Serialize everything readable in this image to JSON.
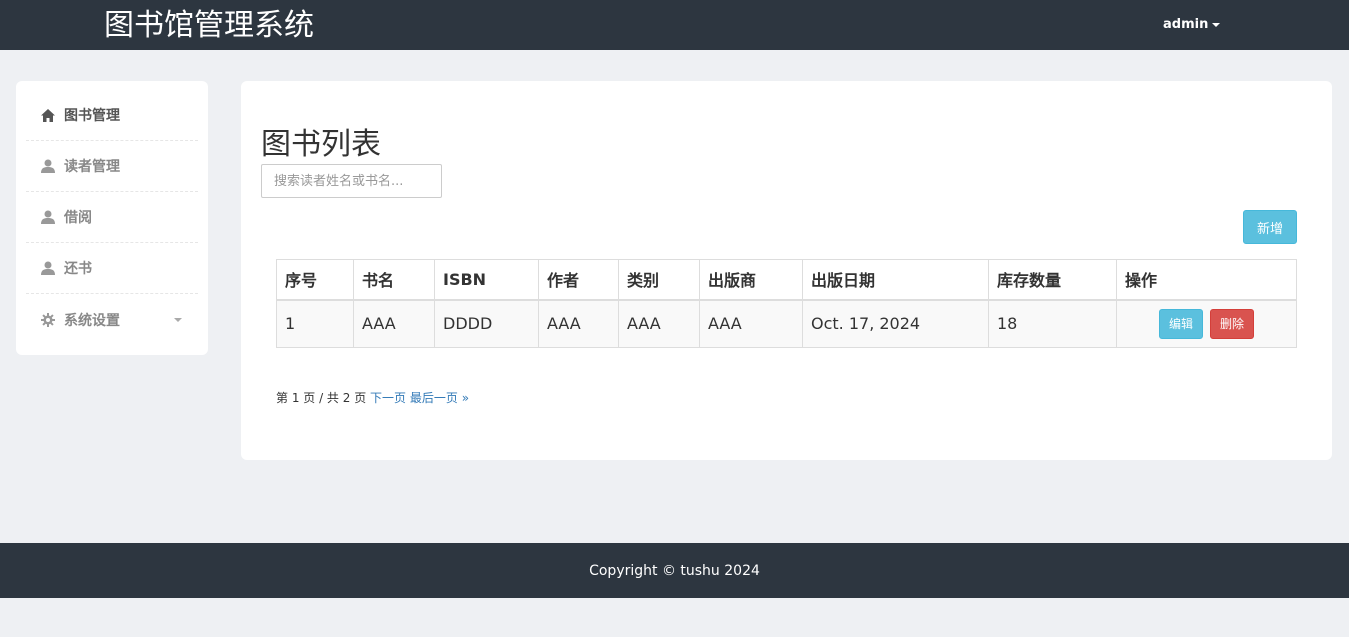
{
  "header": {
    "brand": "图书馆管理系统",
    "user": "admin"
  },
  "sidebar": {
    "items": [
      {
        "label": "图书管理",
        "icon": "home-icon"
      },
      {
        "label": "读者管理",
        "icon": "user-icon"
      },
      {
        "label": "借阅",
        "icon": "user-icon"
      },
      {
        "label": "还书",
        "icon": "user-icon"
      },
      {
        "label": "系统设置",
        "icon": "gear-icon"
      }
    ]
  },
  "main": {
    "title": "图书列表",
    "search_placeholder": "搜索读者姓名或书名...",
    "add_label": "新增",
    "table": {
      "headers": [
        "序号",
        "书名",
        "ISBN",
        "作者",
        "类别",
        "出版商",
        "出版日期",
        "库存数量",
        "操作"
      ],
      "rows": [
        [
          "1",
          "AAA",
          "DDDD",
          "AAA",
          "AAA",
          "AAA",
          "Oct. 17, 2024",
          "18"
        ]
      ],
      "edit_label": "编辑",
      "delete_label": "删除"
    },
    "pager": {
      "info": "第 1 页 / 共 2 页",
      "next": "下一页",
      "last": "最后一页 »"
    }
  },
  "footer": {
    "copyright": "Copyright © tushu 2024"
  },
  "colors": {
    "navbar": "#2d3640",
    "info": "#5bc0de",
    "danger": "#d9534f",
    "link": "#337ab7"
  }
}
